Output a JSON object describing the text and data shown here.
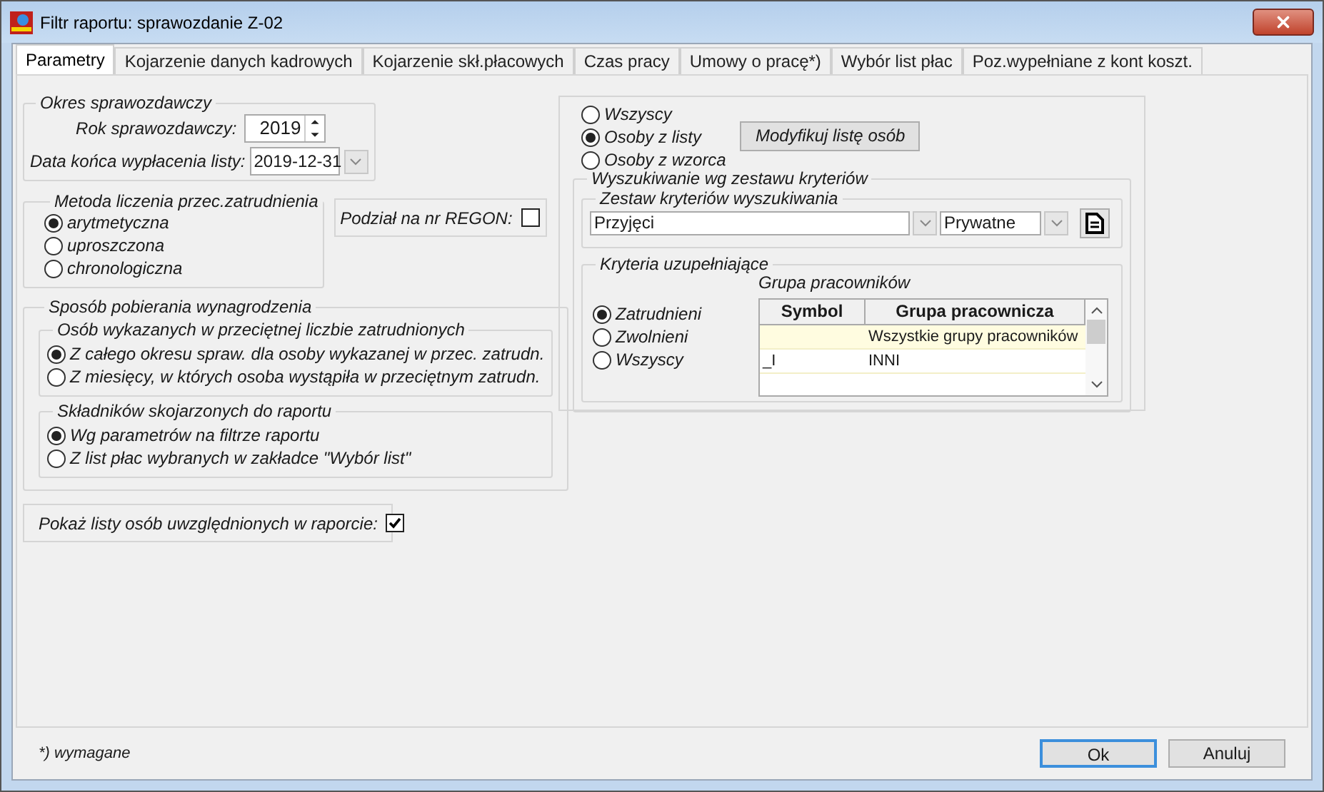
{
  "window": {
    "title": "Filtr raportu: sprawozdanie Z-02"
  },
  "tabs": [
    {
      "label": "Parametry",
      "selected": true
    },
    {
      "label": "Kojarzenie danych kadrowych",
      "selected": false
    },
    {
      "label": "Kojarzenie skł.płacowych",
      "selected": false
    },
    {
      "label": "Czas pracy",
      "selected": false
    },
    {
      "label": "Umowy o pracę*)",
      "selected": false
    },
    {
      "label": "Wybór list płac",
      "selected": false
    },
    {
      "label": "Poz.wypełniane z kont koszt.",
      "selected": false
    }
  ],
  "okres": {
    "title": "Okres sprawozdawczy",
    "year_label": "Rok sprawozdawczy:",
    "year": "2019",
    "date_label": "Data końca wypłacenia listy:",
    "date": "2019-12-31"
  },
  "metoda": {
    "title": "Metoda liczenia przec.zatrudnienia",
    "options": [
      {
        "label": "arytmetyczna",
        "selected": true
      },
      {
        "label": "uproszczona",
        "selected": false
      },
      {
        "label": "chronologiczna",
        "selected": false
      }
    ]
  },
  "regon": {
    "label": "Podział na nr REGON:",
    "checked": false
  },
  "sposob": {
    "title": "Sposób pobierania wynagrodzenia",
    "groups": [
      {
        "title": "Osób wykazanych w przeciętnej liczbie zatrudnionych",
        "options": [
          {
            "label": "Z całego okresu spraw. dla osoby wykazanej w przec. zatrudn.",
            "selected": true
          },
          {
            "label": "Z miesięcy, w których osoba wystąpiła w przeciętnym zatrudn.",
            "selected": false
          }
        ]
      },
      {
        "title": "Składników skojarzonych do raportu",
        "options": [
          {
            "label": "Wg parametrów na filtrze raportu",
            "selected": true
          },
          {
            "label": "Z list płac wybranych w zakładce \"Wybór list\"",
            "selected": false
          }
        ]
      }
    ]
  },
  "pokaz": {
    "label": "Pokaż listy osób uwzględnionych w raporcie:",
    "checked": true
  },
  "osoby": {
    "options": [
      {
        "label": "Wszyscy",
        "selected": false
      },
      {
        "label": "Osoby z listy",
        "selected": true
      },
      {
        "label": "Osoby z wzorca",
        "selected": false
      }
    ],
    "button": "Modyfikuj listę osób"
  },
  "wyszukiwanie": {
    "title": "Wyszukiwanie wg zestawu kryteriów",
    "zestaw": {
      "title": "Zestaw kryteriów wyszukiwania",
      "criteria": "Przyjęci",
      "scope": "Prywatne"
    },
    "kryteria": {
      "title": "Kryteria uzupełniające",
      "options": [
        {
          "label": "Zatrudnieni",
          "selected": true
        },
        {
          "label": "Zwolnieni",
          "selected": false
        },
        {
          "label": "Wszyscy",
          "selected": false
        }
      ],
      "table": {
        "title": "Grupa pracowników",
        "columns": [
          "Symbol",
          "Grupa pracownicza"
        ],
        "rows": [
          {
            "cells": [
              "",
              "Wszystkie grupy pracowników"
            ],
            "selected": true
          },
          {
            "cells": [
              "_I",
              "INNI"
            ],
            "selected": false
          }
        ]
      }
    }
  },
  "footer": {
    "note": "*) wymagane",
    "buttons": [
      {
        "label": "Ok",
        "kind": "default"
      },
      {
        "label": "Anuluj",
        "kind": "normal"
      }
    ]
  }
}
